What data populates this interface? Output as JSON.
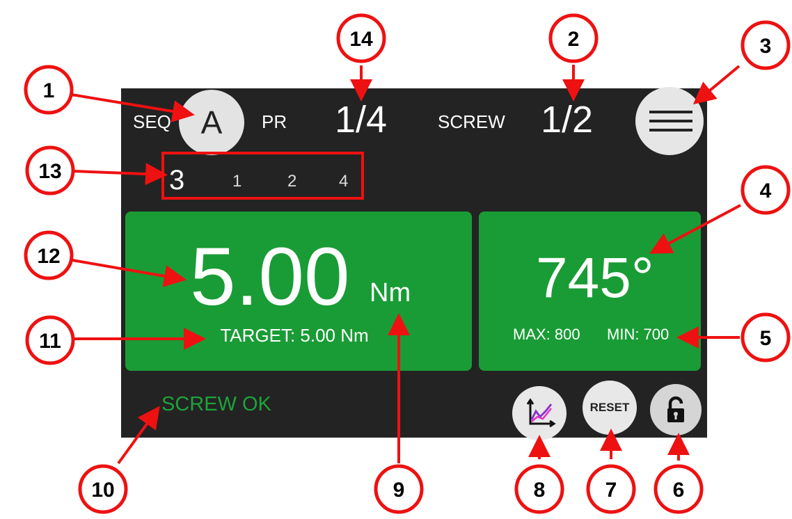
{
  "header": {
    "seq_label": "SEQ",
    "seq_value": "A",
    "pr_label": "PR",
    "pr_value": "1/4",
    "screw_label": "SCREW",
    "screw_value": "1/2",
    "menu_icon": "hamburger-menu-icon"
  },
  "steps": {
    "current": "3",
    "items": [
      "1",
      "2",
      "4"
    ]
  },
  "torque": {
    "value": "5.00",
    "unit": "Nm",
    "target": "TARGET: 5.00 Nm"
  },
  "angle": {
    "value": "745°",
    "max": "MAX: 800",
    "min": "MIN: 700"
  },
  "status": {
    "text": "SCREW OK"
  },
  "buttons": {
    "graph_icon": "graph-icon",
    "reset_label": "RESET",
    "lock_icon": "unlock-icon"
  },
  "colors": {
    "screen_background": "#232323",
    "panel_ok": "#199c35",
    "status_ok": "#1ea33a",
    "callout": "#ee1111"
  },
  "callouts": [
    "1",
    "2",
    "3",
    "4",
    "5",
    "6",
    "7",
    "8",
    "9",
    "10",
    "11",
    "12",
    "13",
    "14"
  ]
}
